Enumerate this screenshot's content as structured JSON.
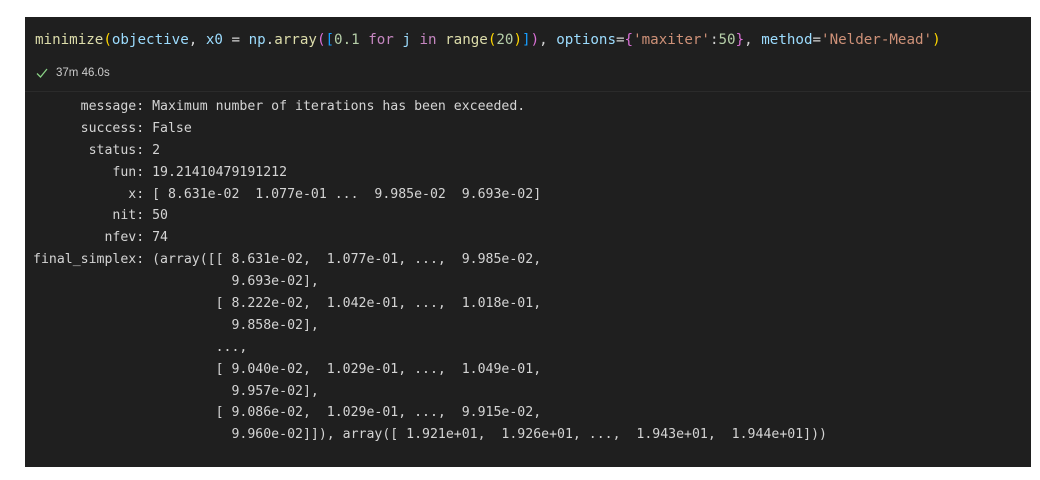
{
  "cell": {
    "code_tokens": [
      {
        "text": "minimize",
        "cls": "t-fn"
      },
      {
        "text": "(",
        "cls": "t-b1"
      },
      {
        "text": "objective",
        "cls": "t-var"
      },
      {
        "text": ", ",
        "cls": "t-pun"
      },
      {
        "text": "x0",
        "cls": "t-var"
      },
      {
        "text": " = ",
        "cls": "t-pun"
      },
      {
        "text": "np",
        "cls": "t-var"
      },
      {
        "text": ".",
        "cls": "t-pun"
      },
      {
        "text": "array",
        "cls": "t-fn"
      },
      {
        "text": "(",
        "cls": "t-b2"
      },
      {
        "text": "[",
        "cls": "t-b3"
      },
      {
        "text": "0.1",
        "cls": "t-num"
      },
      {
        "text": " ",
        "cls": "t-pun"
      },
      {
        "text": "for",
        "cls": "t-kw"
      },
      {
        "text": " ",
        "cls": "t-pun"
      },
      {
        "text": "j",
        "cls": "t-var"
      },
      {
        "text": " ",
        "cls": "t-pun"
      },
      {
        "text": "in",
        "cls": "t-kw"
      },
      {
        "text": " ",
        "cls": "t-pun"
      },
      {
        "text": "range",
        "cls": "t-fn"
      },
      {
        "text": "(",
        "cls": "t-b1"
      },
      {
        "text": "20",
        "cls": "t-num"
      },
      {
        "text": ")",
        "cls": "t-b1"
      },
      {
        "text": "]",
        "cls": "t-b3"
      },
      {
        "text": ")",
        "cls": "t-b2"
      },
      {
        "text": ", ",
        "cls": "t-pun"
      },
      {
        "text": "options",
        "cls": "t-var"
      },
      {
        "text": "=",
        "cls": "t-pun"
      },
      {
        "text": "{",
        "cls": "t-b2"
      },
      {
        "text": "'maxiter'",
        "cls": "t-str"
      },
      {
        "text": ":",
        "cls": "t-pun"
      },
      {
        "text": "50",
        "cls": "t-num"
      },
      {
        "text": "}",
        "cls": "t-b2"
      },
      {
        "text": ", ",
        "cls": "t-pun"
      },
      {
        "text": "method",
        "cls": "t-var"
      },
      {
        "text": "=",
        "cls": "t-pun"
      },
      {
        "text": "'Nelder-Mead'",
        "cls": "t-str"
      },
      {
        "text": ")",
        "cls": "t-b1"
      }
    ],
    "status_icon": "check-icon",
    "status_color": "#89d185",
    "duration": "37m 46.0s"
  },
  "output": {
    "lines": [
      "      message: Maximum number of iterations has been exceeded.",
      "      success: False",
      "       status: 2",
      "          fun: 19.21410479191212",
      "            x: [ 8.631e-02  1.077e-01 ...  9.985e-02  9.693e-02]",
      "          nit: 50",
      "         nfev: 74",
      "final_simplex: (array([[ 8.631e-02,  1.077e-01, ...,  9.985e-02,",
      "                         9.693e-02],",
      "                       [ 8.222e-02,  1.042e-01, ...,  1.018e-01,",
      "                         9.858e-02],",
      "                       ...,",
      "                       [ 9.040e-02,  1.029e-01, ...,  1.049e-01,",
      "                         9.957e-02],",
      "                       [ 9.086e-02,  1.029e-01, ...,  9.915e-02,",
      "                         9.960e-02]]), array([ 1.921e+01,  1.926e+01, ...,  1.943e+01,  1.944e+01]))"
    ],
    "text_color": "#d4d4d4",
    "background": "#1f1f1f"
  }
}
